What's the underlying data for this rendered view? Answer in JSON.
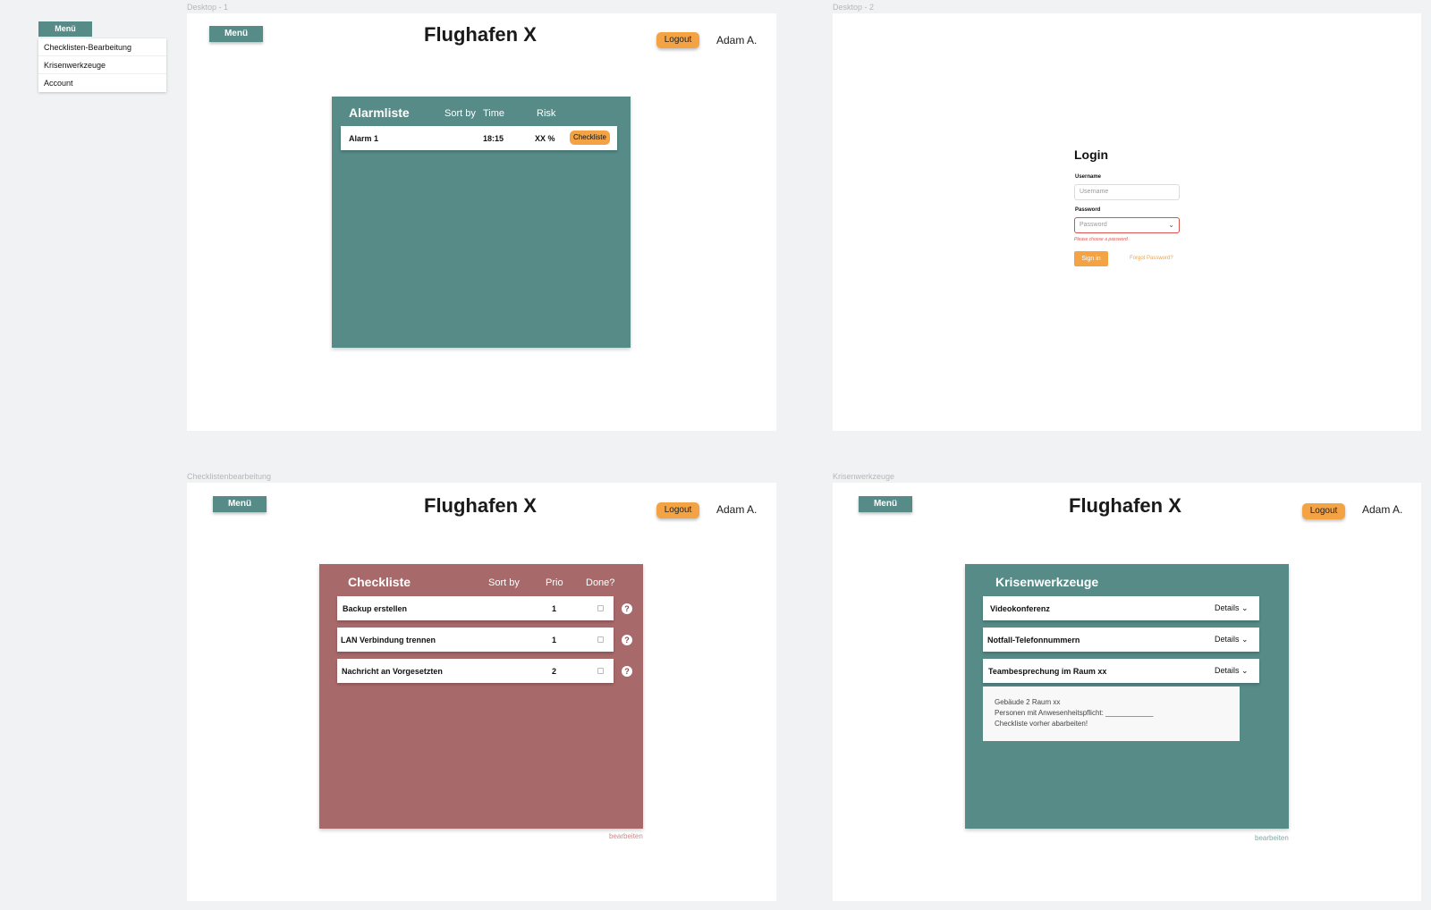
{
  "side_menu": {
    "button": "Menü",
    "items": [
      "Checklisten-Bearbeitung",
      "Krisenwerkzeuge",
      "Account"
    ]
  },
  "frames": {
    "desktop1": "Desktop - 1",
    "desktop2": "Desktop - 2",
    "checklist": "Checklistenbearbeitung",
    "krisen": "Krisenwerkzeuge"
  },
  "header": {
    "menu": "Menü",
    "title": "Flughafen X",
    "logout": "Logout",
    "user": "Adam A."
  },
  "alarm": {
    "title": "Alarmliste",
    "sort_by": "Sort by",
    "time": "Time",
    "risk": "Risk",
    "rows": [
      {
        "name": "Alarm 1",
        "time": "18:15",
        "risk": "XX %",
        "action": "Checkliste"
      }
    ]
  },
  "login": {
    "title": "Login",
    "username_label": "Username",
    "username_placeholder": "Username",
    "password_label": "Password",
    "password_placeholder": "Password",
    "error": "Please choose a password",
    "signin": "Sign in",
    "forgot": "Forgot Password?"
  },
  "checklist": {
    "title": "Checkliste",
    "sort_by": "Sort by",
    "prio": "Prio",
    "done": "Done?",
    "rows": [
      {
        "task": "Backup erstellen",
        "prio": "1"
      },
      {
        "task": "LAN Verbindung trennen",
        "prio": "1"
      },
      {
        "task": "Nachricht an Vorgesetzten",
        "prio": "2"
      }
    ],
    "edit": "bearbeiten",
    "help": "?"
  },
  "krisen": {
    "title": "Krisenwerkzeuge",
    "rows": [
      {
        "name": "Videokonferenz",
        "details": "Details"
      },
      {
        "name": "Notfall-Telefonnummern",
        "details": "Details"
      },
      {
        "name": "Teambesprechung im Raum xx",
        "details": "Details"
      }
    ],
    "expanded": [
      "Gebäude 2 Raum xx",
      "Personen mit Anwesenheitspflicht: ____________",
      "Checkliste vorher abarbeiten!"
    ],
    "edit": "bearbeiten"
  },
  "colors": {
    "teal": "#568b88",
    "rose": "#a8696a",
    "orange": "#f3a343"
  }
}
